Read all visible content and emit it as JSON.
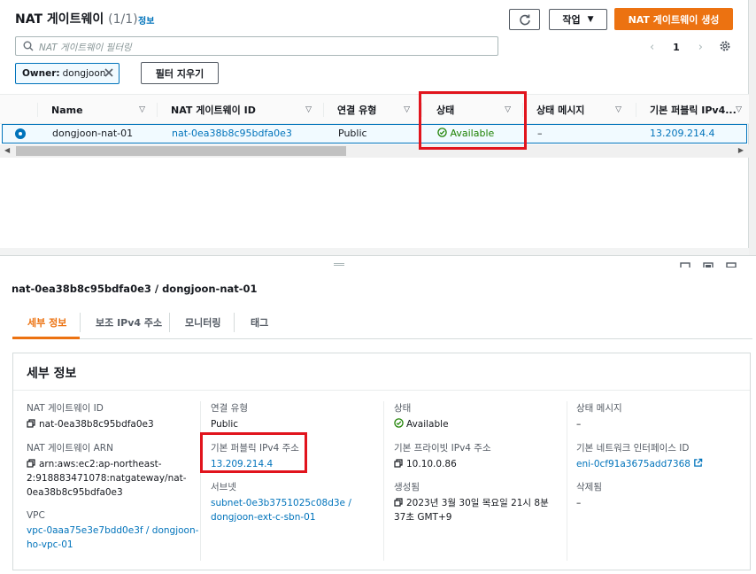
{
  "header": {
    "title": "NAT 게이트웨이",
    "count": "(1/1)",
    "info": "정보",
    "actions_label": "작업",
    "create_label": "NAT 게이트웨이 생성"
  },
  "filter": {
    "placeholder": "NAT 게이트웨이 필터링",
    "token_key": "Owner:",
    "token_value": "dongjoon",
    "clear_label": "필터 지우기"
  },
  "pagination": {
    "page": "1"
  },
  "table": {
    "columns": [
      "Name",
      "NAT 게이트웨이 ID",
      "연결 유형",
      "상태",
      "상태 메시지",
      "기본 퍼블릭 IPv4..."
    ],
    "row": {
      "name": "dongjoon-nat-01",
      "id": "nat-0ea38b8c95bdfa0e3",
      "type": "Public",
      "state": "Available",
      "state_message": "–",
      "public_ip": "13.209.214.4"
    }
  },
  "detail": {
    "heading": "nat-0ea38b8c95bdfa0e3 / dongjoon-nat-01",
    "tabs": [
      "세부 정보",
      "보조 IPv4 주소",
      "모니터링",
      "태그"
    ],
    "card_title": "세부 정보",
    "fields": {
      "id_label": "NAT 게이트웨이 ID",
      "id_value": "nat-0ea38b8c95bdfa0e3",
      "arn_label": "NAT 게이트웨이 ARN",
      "arn_line1": "arn:aws:ec2:ap-northeast-",
      "arn_line2": "2:918883471078:natgateway/nat-",
      "arn_line3": "0ea38b8c95bdfa0e3",
      "vpc_label": "VPC",
      "vpc_line1": "vpc-0aaa75e3e7bdd0e3f / dongjoon-",
      "vpc_line2": "ho-vpc-01",
      "type_label": "연결 유형",
      "type_value": "Public",
      "pubip_label": "기본 퍼블릭 IPv4 주소",
      "pubip_value": "13.209.214.4",
      "subnet_label": "서브넷",
      "subnet_line1": "subnet-0e3b3751025c08d3e /",
      "subnet_line2": "dongjoon-ext-c-sbn-01",
      "state_label": "상태",
      "state_value": "Available",
      "privip_label": "기본 프라이빗 IPv4 주소",
      "privip_value": "10.10.0.86",
      "created_label": "생성됨",
      "created_line1": "2023년 3월 30일 목요일 21시 8분",
      "created_line2": "37초 GMT+9",
      "msg_label": "상태 메시지",
      "msg_value": "–",
      "eni_label": "기본 네트워크 인터페이스 ID",
      "eni_value": "eni-0cf91a3675add7368",
      "deleted_label": "삭제됨",
      "deleted_value": "–"
    }
  },
  "colors": {
    "accent": "#ec7211",
    "link": "#0073bb",
    "success": "#1d8102",
    "highlight": "#e1141d"
  }
}
